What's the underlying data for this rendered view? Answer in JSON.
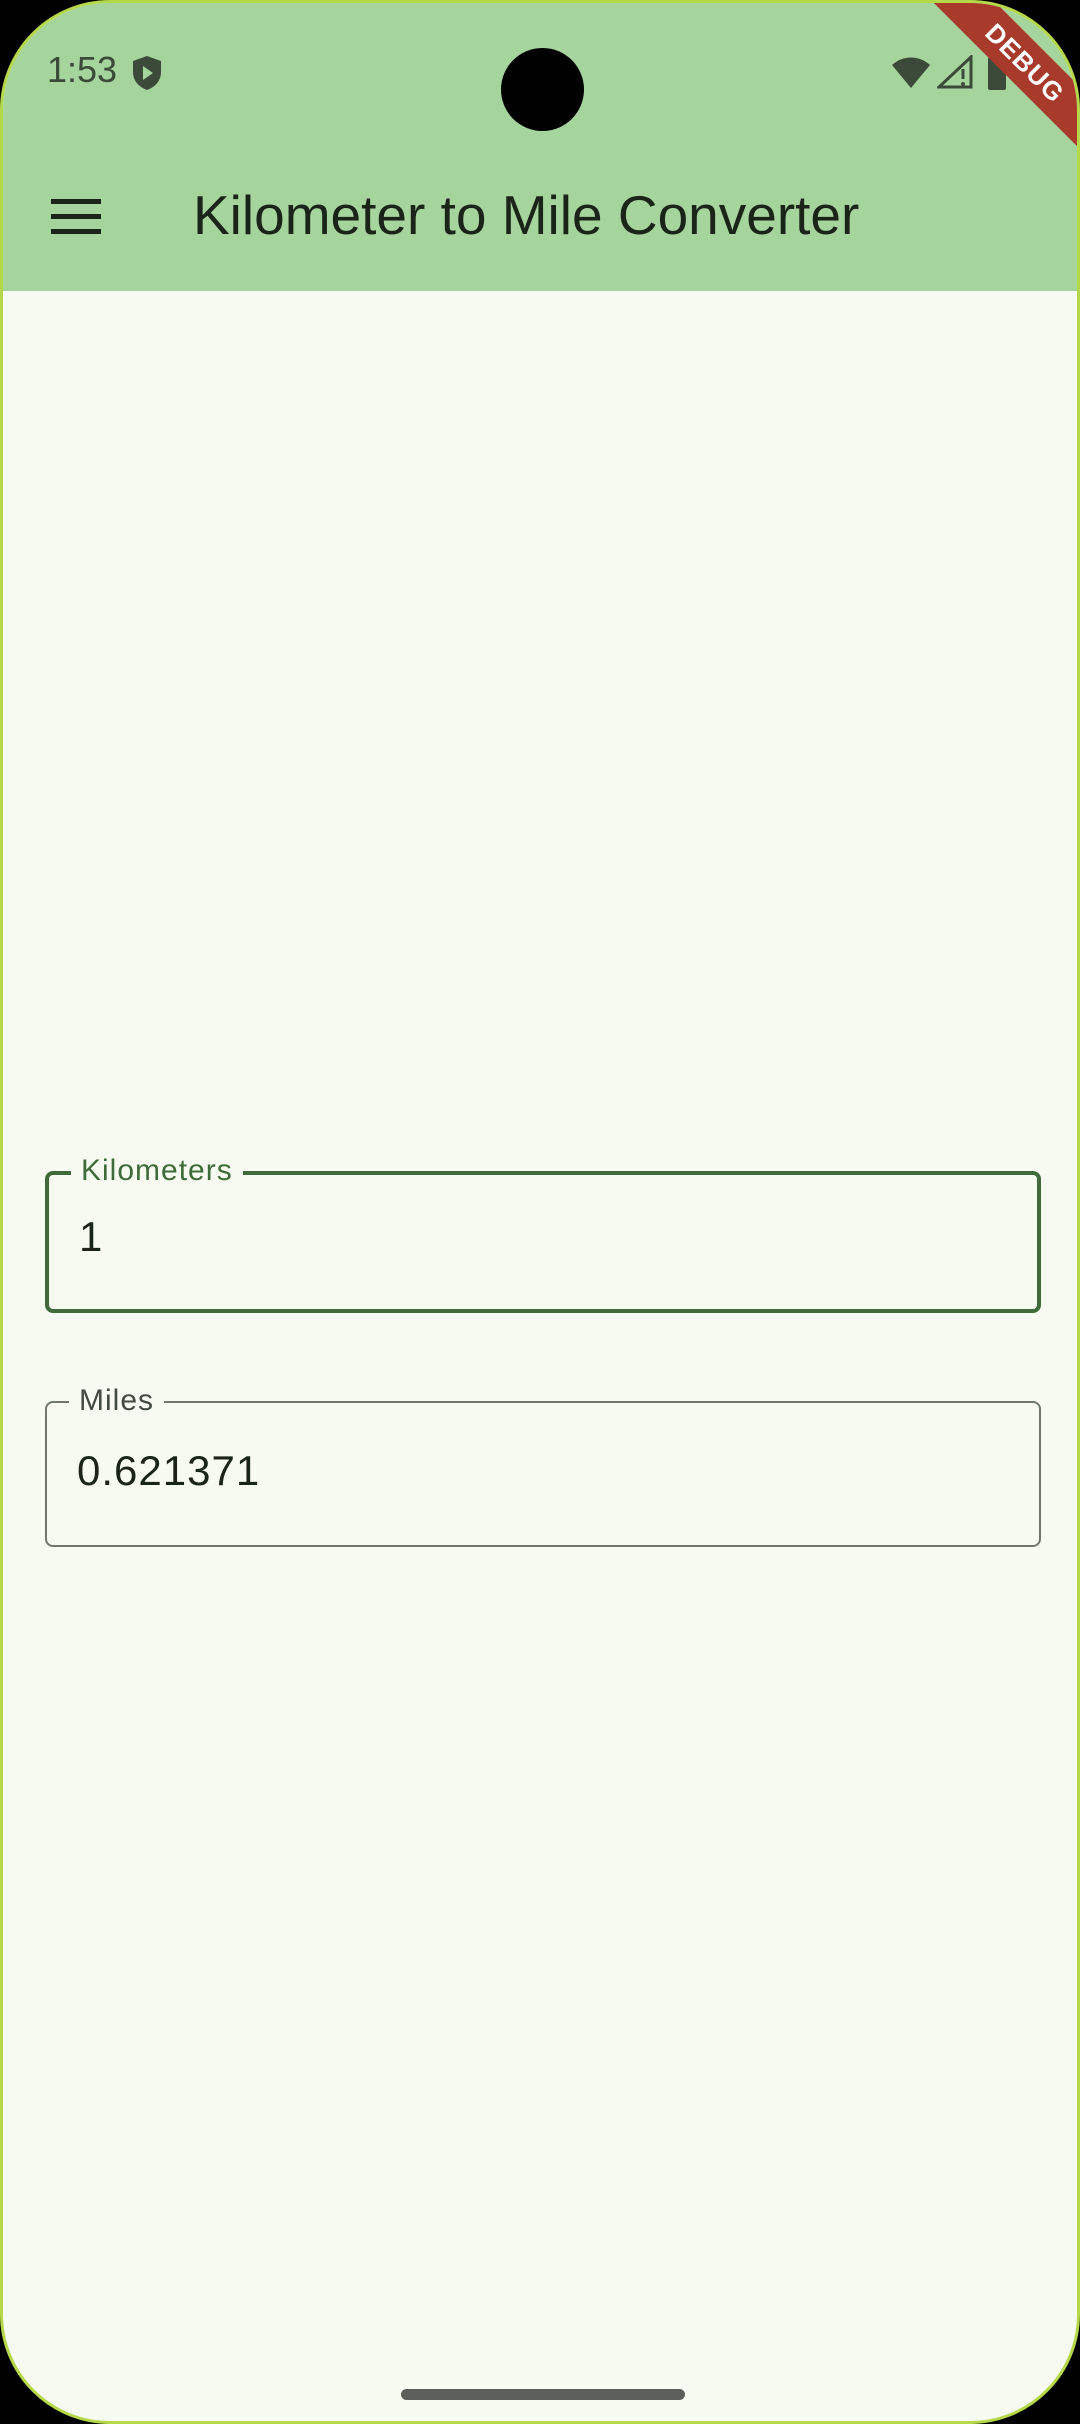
{
  "status_bar": {
    "time": "1:53",
    "icons": [
      "shield-play-icon",
      "wifi-icon",
      "signal-icon",
      "battery-icon"
    ]
  },
  "debug_banner": "DEBUG",
  "app_bar": {
    "title": "Kilometer to Mile Converter",
    "menu_icon": "hamburger-menu-icon",
    "background_color": "#a5d49c"
  },
  "fields": {
    "kilometers": {
      "label": "Kilometers",
      "value": "1",
      "focused": true
    },
    "miles": {
      "label": "Miles",
      "value": "0.621371",
      "focused": false
    }
  },
  "colors": {
    "background": "#f7faf1",
    "accent": "#3f6b3a",
    "debug": "#a83a2c"
  }
}
